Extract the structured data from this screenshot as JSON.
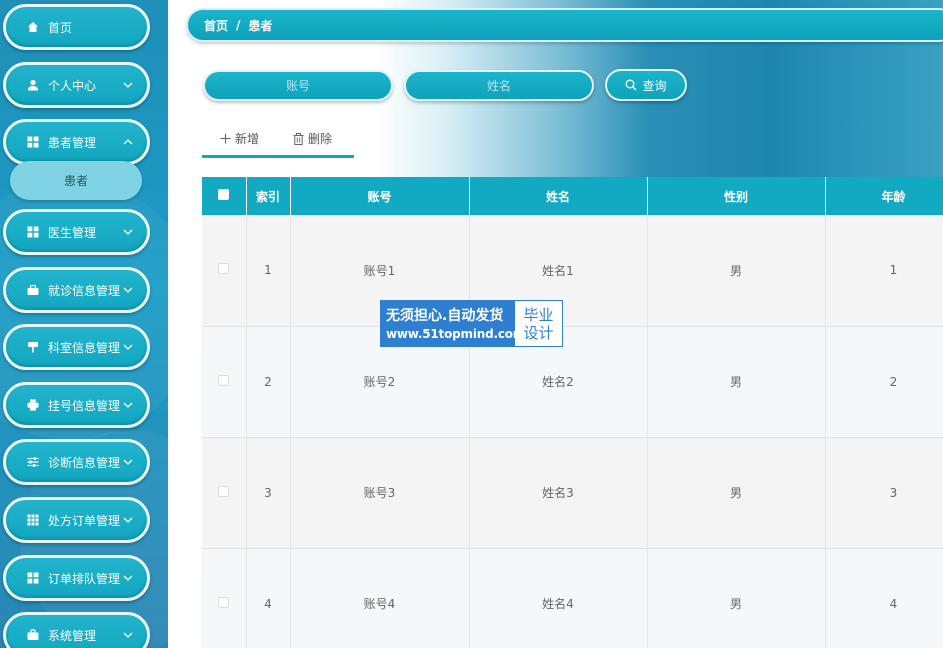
{
  "sidebar": {
    "items": [
      {
        "label": "首页",
        "icon": "home-icon",
        "has_chevron": false
      },
      {
        "label": "个人中心",
        "icon": "user-icon",
        "has_chevron": true
      },
      {
        "label": "患者管理",
        "icon": "grid-icon",
        "has_chevron": true
      },
      {
        "label": "医生管理",
        "icon": "grid-icon",
        "has_chevron": true
      },
      {
        "label": "就诊信息管理",
        "icon": "briefcase-icon",
        "has_chevron": true
      },
      {
        "label": "科室信息管理",
        "icon": "signpost-icon",
        "has_chevron": true
      },
      {
        "label": "挂号信息管理",
        "icon": "printer-icon",
        "has_chevron": true
      },
      {
        "label": "诊断信息管理",
        "icon": "sliders-icon",
        "has_chevron": true
      },
      {
        "label": "处方订单管理",
        "icon": "apps-icon",
        "has_chevron": true
      },
      {
        "label": "订单排队管理",
        "icon": "grid-icon",
        "has_chevron": true
      },
      {
        "label": "系统管理",
        "icon": "toolbox-icon",
        "has_chevron": true
      }
    ],
    "submenu_active": "患者"
  },
  "breadcrumb": {
    "home": "首页",
    "separator": "/",
    "current": "患者"
  },
  "search": {
    "account_placeholder": "账号",
    "name_placeholder": "姓名",
    "button_label": "查询"
  },
  "actions": {
    "add_label": "新增",
    "delete_label": "删除"
  },
  "table": {
    "headers": [
      "索引",
      "账号",
      "姓名",
      "性别",
      "年龄"
    ],
    "rows": [
      {
        "index": "1",
        "account": "账号1",
        "name": "姓名1",
        "gender": "男",
        "age": "1"
      },
      {
        "index": "2",
        "account": "账号2",
        "name": "姓名2",
        "gender": "男",
        "age": "2"
      },
      {
        "index": "3",
        "account": "账号3",
        "name": "姓名3",
        "gender": "男",
        "age": "3"
      },
      {
        "index": "4",
        "account": "账号4",
        "name": "姓名4",
        "gender": "男",
        "age": "4"
      }
    ]
  },
  "watermark": {
    "line1": "无须担心.自动发货",
    "line2": "www.51topmind.com",
    "right_top": "毕业",
    "right_bottom": "设计"
  },
  "colors": {
    "accent": "#12a9c2",
    "sidebar": "#1b9cc6",
    "watermark": "#2e7fd0"
  }
}
